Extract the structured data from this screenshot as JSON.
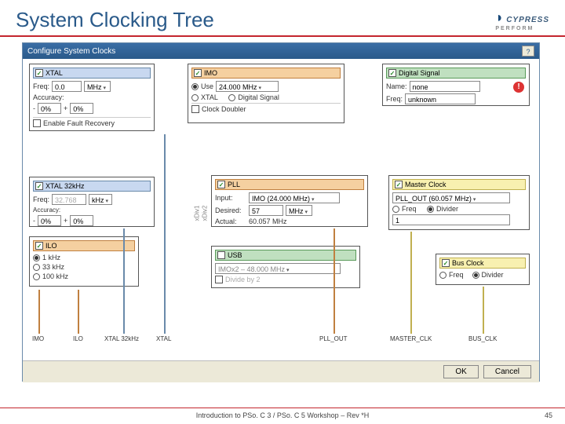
{
  "slide": {
    "title": "System Clocking Tree",
    "footer": "Introduction to PSo. C 3 / PSo. C 5 Workshop – Rev *H",
    "page": "45",
    "logo": "CYPRESS",
    "logo_sub": "PERFORM"
  },
  "win": {
    "title": "Configure System Clocks",
    "help": "?",
    "ok": "OK",
    "cancel": "Cancel"
  },
  "xtal": {
    "title": "XTAL",
    "freq_lbl": "Freq:",
    "freq_val": "0.0",
    "freq_unit": "MHz",
    "acc_lbl": "Accuracy:",
    "acc_minus": "-",
    "acc_mv": "0%",
    "acc_plus": "+",
    "acc_pv": "0%",
    "fault_cb": "Enable Fault Recovery"
  },
  "imo": {
    "title": "IMO",
    "use_lbl": "Use",
    "use_val": "24.000 MHz",
    "xtal_lbl": "XTAL",
    "dsi_lbl": "Digital Signal",
    "doubler_lbl": "Clock Doubler"
  },
  "dsi": {
    "title": "Digital Signal",
    "name_lbl": "Name:",
    "name_val": "none",
    "freq_lbl": "Freq:",
    "freq_val": "unknown"
  },
  "xtal32": {
    "title": "XTAL 32kHz",
    "freq_lbl": "Freq:",
    "freq_val": "32.768",
    "freq_unit": "kHz",
    "acc_lbl": "Accuracy:",
    "acc_minus": "-",
    "acc_mv": "0%",
    "acc_plus": "+",
    "acc_pv": "0%"
  },
  "pll": {
    "title": "PLL",
    "input_lbl": "Input:",
    "input_val": "IMO (24.000 MHz)",
    "desired_lbl": "Desired:",
    "desired_val": "57",
    "desired_unit": "MHz",
    "actual_lbl": "Actual:",
    "actual_val": "60.057 MHz"
  },
  "master": {
    "title": "Master Clock",
    "sel": "PLL_OUT (60.057 MHz)",
    "freq_lbl": "Freq",
    "div_lbl": "Divider",
    "div_val": "1"
  },
  "ilo": {
    "title": "ILO",
    "r1": "1 kHz",
    "r2": "33 kHz",
    "r3": "100 kHz"
  },
  "usb": {
    "title": "USB",
    "src": "IMOx2 – 48.000 MHz",
    "div2": "Divide by 2"
  },
  "bus": {
    "title": "Bus Clock",
    "freq_lbl": "Freq",
    "div_lbl": "Divider"
  },
  "out": {
    "imo": "IMO",
    "ilo": "ILO",
    "x32": "XTAL 32kHz",
    "xtal": "XTAL",
    "pll": "PLL_OUT",
    "master": "MASTER_CLK",
    "bus": "BUS_CLK"
  },
  "misc": {
    "xdiv1": "xDiv1",
    "xdiv2": "xDiv2"
  }
}
